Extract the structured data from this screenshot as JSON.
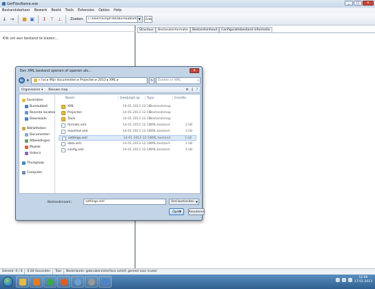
{
  "window": {
    "title": "GetFilesName.exe"
  },
  "menu": [
    "Bestandsbeheer",
    "Bewerk",
    "Beeld",
    "Tools",
    "Extensies",
    "Opties",
    "Help"
  ],
  "toolbar": {
    "search_label": "Zoeken",
    "path_combo": "C:\\Users\\Ivo\\pf-dsk\\Bureaublad\\",
    "small_combo": "Zoek"
  },
  "left_pane": {
    "hint": "Klik om een bestand te kiezen..."
  },
  "right_pane": {
    "tabs": [
      "Structuur",
      "Bestandsinformatie",
      "Bestandsinhoud",
      "Configuratiebestand informatie"
    ]
  },
  "statusbar": [
    "Gereed: 0 / 0",
    "0.00 Seconden",
    "Taal",
    "Nederlands: gebruikersinterface actief; gereed voor invoer"
  ],
  "taskbar": {
    "clock_time": "12:09",
    "clock_date": "17-01-2013",
    "apps": [
      {
        "name": "explorer",
        "color": "#e6b949"
      },
      {
        "name": "media",
        "color": "#e57a1f"
      },
      {
        "name": "chrome",
        "color": "#3aa84e"
      },
      {
        "name": "firefox",
        "color": "#e55b1e"
      },
      {
        "name": "network",
        "color": "#6b9fd6"
      },
      {
        "name": "settings",
        "color": "#9a9a9a"
      },
      {
        "name": "app",
        "color": "#4b84c8"
      }
    ]
  },
  "dialog": {
    "title": "Een XML bestand openen of openen als...",
    "address": "« Ivo ▸ Mijn documenten ▸ Projecten ▸ 2013 ▸ XML ▸",
    "search_placeholder": "Zoeken in XML",
    "organize": "Organiseren ▾",
    "new_folder": "Nieuwe map",
    "nav": [
      {
        "label": "Favorieten",
        "color": "#e8c04a",
        "sub": false
      },
      {
        "label": "Bureaublad",
        "color": "#4d7fbf",
        "sub": true
      },
      {
        "label": "Recente locaties",
        "color": "#6d93c9",
        "sub": true
      },
      {
        "label": "Downloads",
        "color": "#4d7fbf",
        "sub": true
      },
      {
        "label": "Bibliotheken",
        "color": "#c9a94a",
        "sub": false
      },
      {
        "label": "Documenten",
        "color": "#8fa9c9",
        "sub": true
      },
      {
        "label": "Afbeeldingen",
        "color": "#6aa06a",
        "sub": true
      },
      {
        "label": "Muziek",
        "color": "#c86a3a",
        "sub": true
      },
      {
        "label": "Video's",
        "color": "#8a6ab0",
        "sub": true
      },
      {
        "label": "Thuisgroep",
        "color": "#3a8ad0",
        "sub": false
      },
      {
        "label": "Computer",
        "color": "#6f8aa8",
        "sub": false
      }
    ],
    "columns": {
      "name": "Naam",
      "date": "Gewijzigd op",
      "type": "Type",
      "size": "Grootte"
    },
    "files": [
      {
        "name": "XML",
        "date": "14-01-2013 12:10",
        "type": "Bestandsmap",
        "size": "",
        "folder": true,
        "selected": false
      },
      {
        "name": "Projecten",
        "date": "14-01-2013 12:10",
        "type": "Bestandsmap",
        "size": "",
        "folder": true,
        "selected": false
      },
      {
        "name": "Tools",
        "date": "14-01-2013 12:10",
        "type": "Bestandsmap",
        "size": "",
        "folder": true,
        "selected": false
      },
      {
        "name": "formats.xml",
        "date": "14-01-2013 12:10",
        "type": "XML-bestand",
        "size": "2 kB",
        "folder": false,
        "selected": false
      },
      {
        "name": "manifest.xml",
        "date": "14-01-2013 12:10",
        "type": "XML-bestand",
        "size": "3 kB",
        "folder": false,
        "selected": false
      },
      {
        "name": "settings.xml",
        "date": "14-01-2013 12:10",
        "type": "XML-bestand",
        "size": "1 kB",
        "folder": false,
        "selected": true
      },
      {
        "name": "data.xml",
        "date": "14-01-2013 12:10",
        "type": "XML-bestand",
        "size": "2 kB",
        "folder": false,
        "selected": false
      },
      {
        "name": "config.xml",
        "date": "14-01-2013 12:10",
        "type": "XML-bestand",
        "size": "5 kB",
        "folder": false,
        "selected": false
      }
    ],
    "filename_label": "Bestandsnaam:",
    "filename_value": "settings.xml",
    "filetype": "Xml-bestanden",
    "open_label": "Open",
    "cancel_label": "Annuleren"
  }
}
